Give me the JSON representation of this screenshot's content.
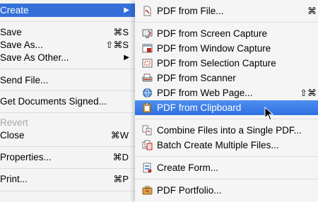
{
  "main_menu": {
    "create": {
      "label": "Create",
      "arrow": "▶"
    },
    "save": {
      "label": "Save",
      "shortcut": "⌘S"
    },
    "save_as": {
      "label": "Save As...",
      "shortcut": "⇧⌘S"
    },
    "save_as_other": {
      "label": "Save As Other...",
      "arrow": "▶"
    },
    "send_file": {
      "label": "Send File..."
    },
    "get_signed": {
      "label": "Get Documents Signed..."
    },
    "revert": {
      "label": "Revert"
    },
    "close": {
      "label": "Close",
      "shortcut": "⌘W"
    },
    "properties": {
      "label": "Properties...",
      "shortcut": "⌘D"
    },
    "print": {
      "label": "Print...",
      "shortcut": "⌘P"
    }
  },
  "submenu": {
    "pdf_from_file": {
      "label": "PDF from File...",
      "shortcut": "⌘",
      "icon": "pdf-file-icon"
    },
    "pdf_from_screen": {
      "label": "PDF from Screen Capture",
      "icon": "screen-capture-icon"
    },
    "pdf_from_window": {
      "label": "PDF from Window Capture",
      "icon": "window-capture-icon"
    },
    "pdf_from_selection": {
      "label": "PDF from Selection Capture",
      "icon": "selection-capture-icon"
    },
    "pdf_from_scanner": {
      "label": "PDF from Scanner",
      "icon": "scanner-icon"
    },
    "pdf_from_web": {
      "label": "PDF from Web Page...",
      "shortcut": "⇧⌘",
      "icon": "web-page-icon"
    },
    "pdf_from_clipboard": {
      "label": "PDF from Clipboard",
      "icon": "clipboard-icon"
    },
    "combine_files": {
      "label": "Combine Files into a Single PDF...",
      "icon": "combine-files-icon"
    },
    "batch_create": {
      "label": "Batch Create Multiple Files...",
      "icon": "batch-create-icon"
    },
    "create_form": {
      "label": "Create Form...",
      "icon": "form-icon"
    },
    "pdf_portfolio": {
      "label": "PDF Portfolio...",
      "icon": "portfolio-icon"
    }
  },
  "colors": {
    "highlight": "#3470d8",
    "disabled_text": "#a7a7a7",
    "pdf_red": "#c8281e"
  }
}
